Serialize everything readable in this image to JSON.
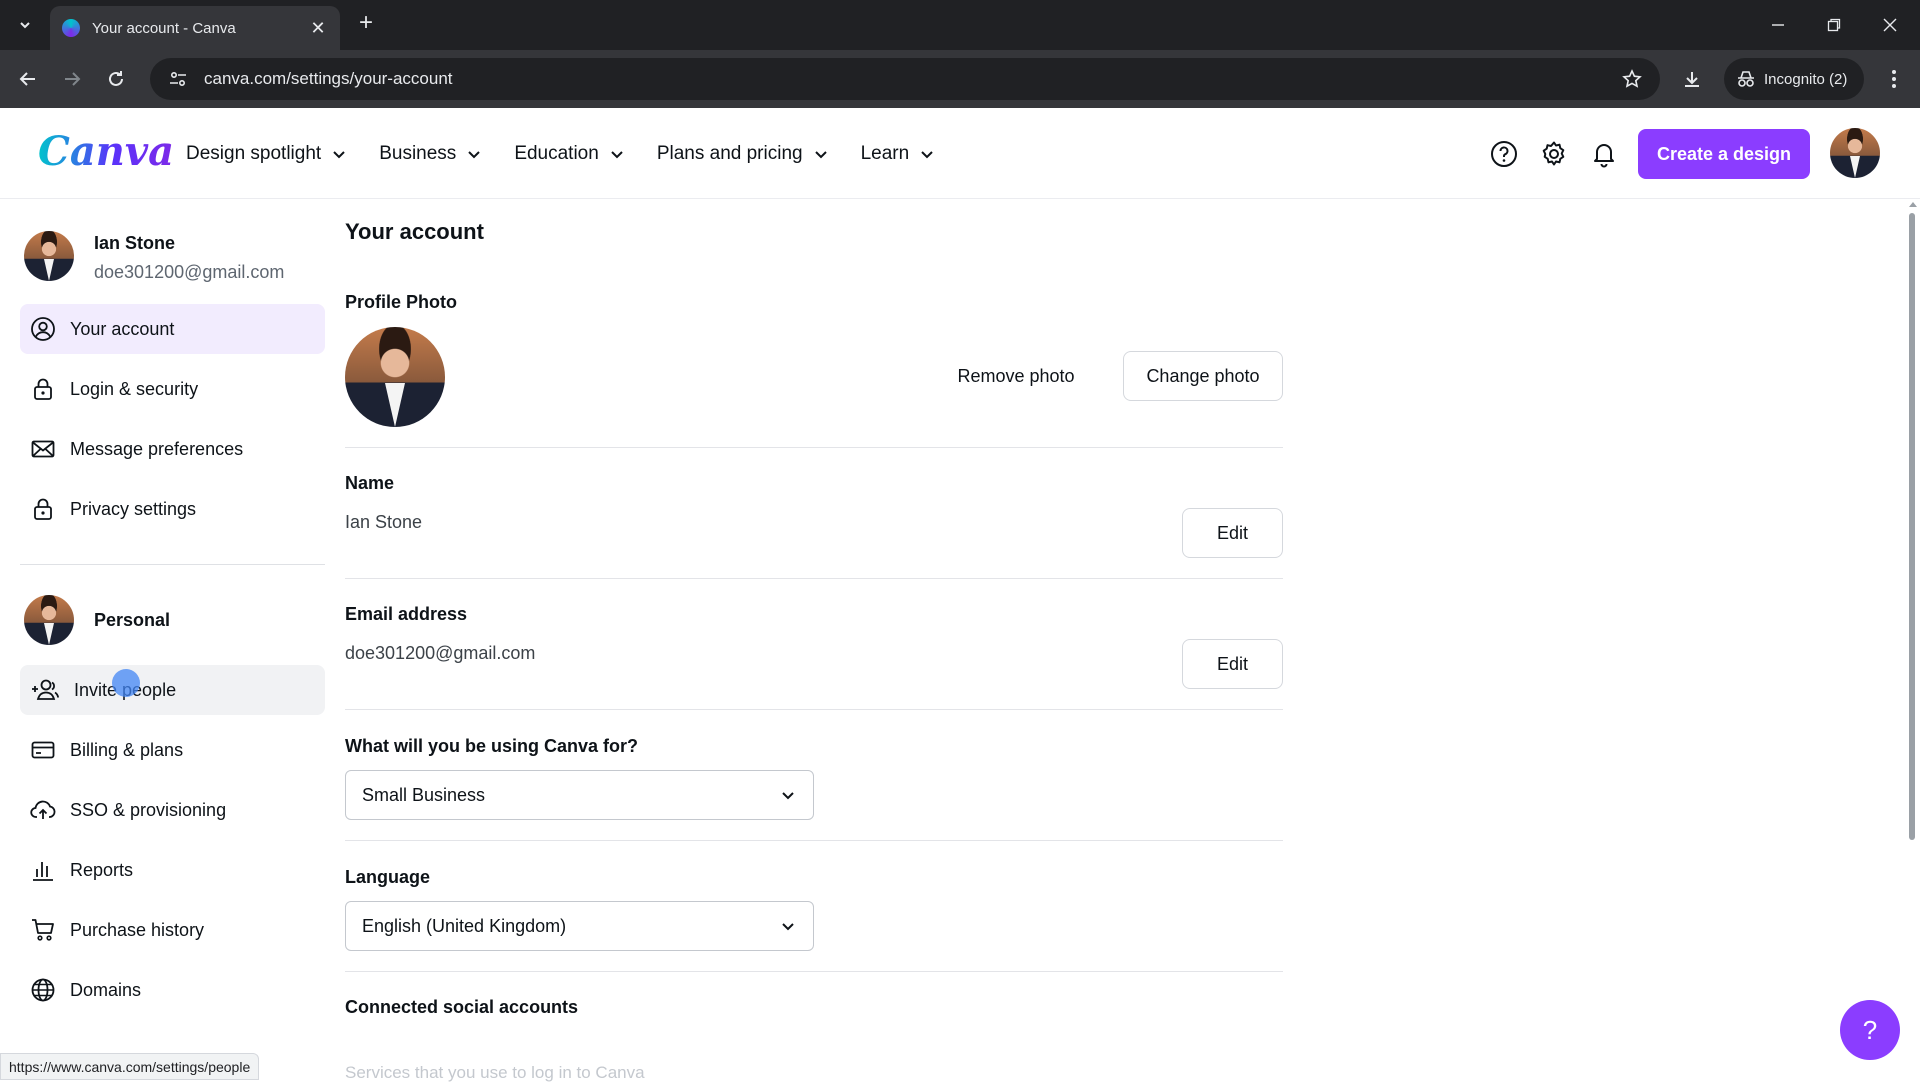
{
  "browser": {
    "tab_title": "Your account - Canva",
    "url": "canva.com/settings/your-account",
    "incognito_label": "Incognito (2)",
    "status_url": "https://www.canva.com/settings/people"
  },
  "header": {
    "logo": "Canva",
    "nav": [
      {
        "label": "Design spotlight"
      },
      {
        "label": "Business"
      },
      {
        "label": "Education"
      },
      {
        "label": "Plans and pricing"
      },
      {
        "label": "Learn"
      }
    ],
    "create_label": "Create a design",
    "accent_color": "#8b3dff"
  },
  "sidebar": {
    "user": {
      "name": "Ian Stone",
      "email": "doe301200@gmail.com"
    },
    "account_items": [
      {
        "label": "Your account",
        "icon": "user-circle-icon",
        "active": true
      },
      {
        "label": "Login & security",
        "icon": "lock-icon"
      },
      {
        "label": "Message preferences",
        "icon": "envelope-icon"
      },
      {
        "label": "Privacy settings",
        "icon": "lock-icon"
      }
    ],
    "team_name": "Personal",
    "team_items": [
      {
        "label": "Invite people",
        "icon": "add-user-icon",
        "hover": true
      },
      {
        "label": "Billing & plans",
        "icon": "credit-card-icon"
      },
      {
        "label": "SSO & provisioning",
        "icon": "cloud-upload-icon"
      },
      {
        "label": "Reports",
        "icon": "bar-chart-icon"
      },
      {
        "label": "Purchase history",
        "icon": "cart-icon"
      },
      {
        "label": "Domains",
        "icon": "globe-icon"
      }
    ]
  },
  "main": {
    "title": "Your account",
    "profile_photo": {
      "label": "Profile Photo",
      "remove_label": "Remove photo",
      "change_label": "Change photo"
    },
    "name": {
      "label": "Name",
      "value": "Ian Stone",
      "edit_label": "Edit"
    },
    "email": {
      "label": "Email address",
      "value": "doe301200@gmail.com",
      "edit_label": "Edit"
    },
    "usage": {
      "label": "What will you be using Canva for?",
      "selected": "Small Business"
    },
    "language": {
      "label": "Language",
      "selected": "English (United Kingdom)"
    },
    "social": {
      "label": "Connected social accounts",
      "description": "Services that you use to log in to Canva"
    }
  },
  "help": {
    "label": "?"
  }
}
